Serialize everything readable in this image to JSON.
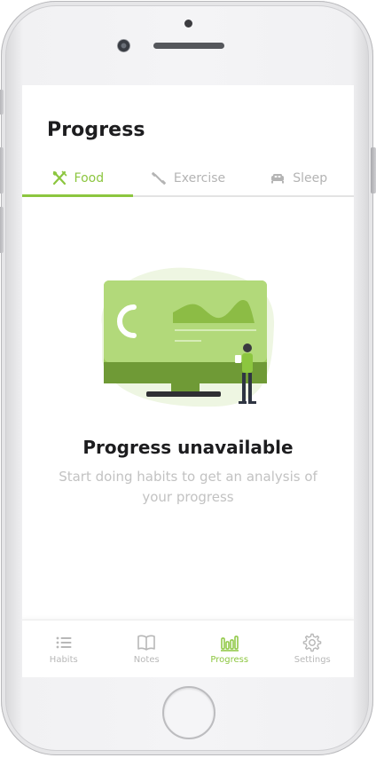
{
  "screen": {
    "title": "Progress"
  },
  "tabs": [
    {
      "label": "Food",
      "icon": "fork-knife-icon",
      "active": true
    },
    {
      "label": "Exercise",
      "icon": "dumbbell-icon",
      "active": false
    },
    {
      "label": "Sleep",
      "icon": "bed-icon",
      "active": false
    }
  ],
  "empty_state": {
    "title": "Progress unavailable",
    "subtitle": "Start doing habits to get an analysis of your progress"
  },
  "bottom_nav": [
    {
      "label": "Habits",
      "icon": "list-icon",
      "active": false
    },
    {
      "label": "Notes",
      "icon": "book-icon",
      "active": false
    },
    {
      "label": "Progress",
      "icon": "bar-chart-icon",
      "active": true
    },
    {
      "label": "Settings",
      "icon": "gear-icon",
      "active": false
    }
  ],
  "colors": {
    "accent": "#8cc63f",
    "inactive": "#b4b4b4",
    "title": "#1d1d1f",
    "subtitle": "#c2c2c2"
  }
}
